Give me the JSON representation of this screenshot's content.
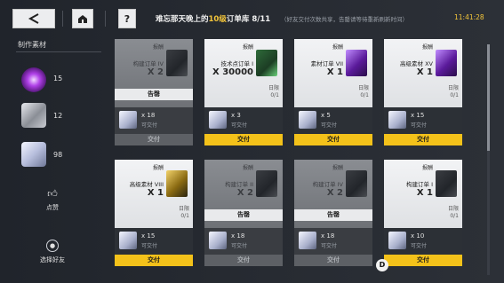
{
  "header": {
    "back_icon": "back-arrow-icon",
    "home_icon": "home-icon",
    "help_label": "?",
    "title_prefix": "难忘那天晚上的",
    "title_highlight": "10级",
    "title_suffix": "订单库",
    "progress": "8/11",
    "subtitle": "（好友交付次数共享，告罄请等待重新刷新时间）",
    "clock": "11:41:28"
  },
  "sidebar": {
    "heading": "制作素材",
    "materials": [
      {
        "name": "purple-orb",
        "count": "15"
      },
      {
        "name": "gray-module",
        "count": "12"
      },
      {
        "name": "crystal-cube",
        "count": "98"
      }
    ],
    "like_label": "点赞",
    "friend_label": "选择好友"
  },
  "cards": [
    {
      "reward_label": "报酬",
      "name": "构建订单 IV",
      "qty": "X 2",
      "times": "",
      "req_qty": "x 18",
      "req_status": "可交付",
      "button": "交付",
      "sold": true,
      "sold_label": "告罄"
    },
    {
      "reward_label": "报酬",
      "name": "技术点订单 I",
      "qty": "X 30000",
      "times": "日限\n0/1",
      "req_qty": "x 3",
      "req_status": "可交付",
      "button": "交付",
      "sold": false
    },
    {
      "reward_label": "报酬",
      "name": "素材订单 VII",
      "qty": "X 1",
      "times": "日限\n0/1",
      "req_qty": "x 5",
      "req_status": "可交付",
      "button": "交付",
      "sold": false
    },
    {
      "reward_label": "报酬",
      "name": "高级素材 XV",
      "qty": "X 1",
      "times": "日限\n0/1",
      "req_qty": "x 15",
      "req_status": "可交付",
      "button": "交付",
      "sold": false
    },
    {
      "reward_label": "报酬",
      "name": "高级素材 VIII",
      "qty": "X 1",
      "times": "日限\n0/1",
      "req_qty": "x 15",
      "req_status": "可交付",
      "button": "交付",
      "sold": false
    },
    {
      "reward_label": "报酬",
      "name": "构建订单 II",
      "qty": "X 2",
      "times": "",
      "req_qty": "x 18",
      "req_status": "可交付",
      "button": "交付",
      "sold": true,
      "sold_label": "告罄"
    },
    {
      "reward_label": "报酬",
      "name": "构建订单 IV",
      "qty": "X 2",
      "times": "",
      "req_qty": "x 18",
      "req_status": "可交付",
      "button": "交付",
      "sold": true,
      "sold_label": "告罄"
    },
    {
      "reward_label": "报酬",
      "name": "构建订单 I",
      "qty": "X 1",
      "times": "日限\n0/1",
      "req_qty": "x 10",
      "req_status": "可交付",
      "button": "交付",
      "sold": false
    }
  ],
  "d_key_label": "D"
}
